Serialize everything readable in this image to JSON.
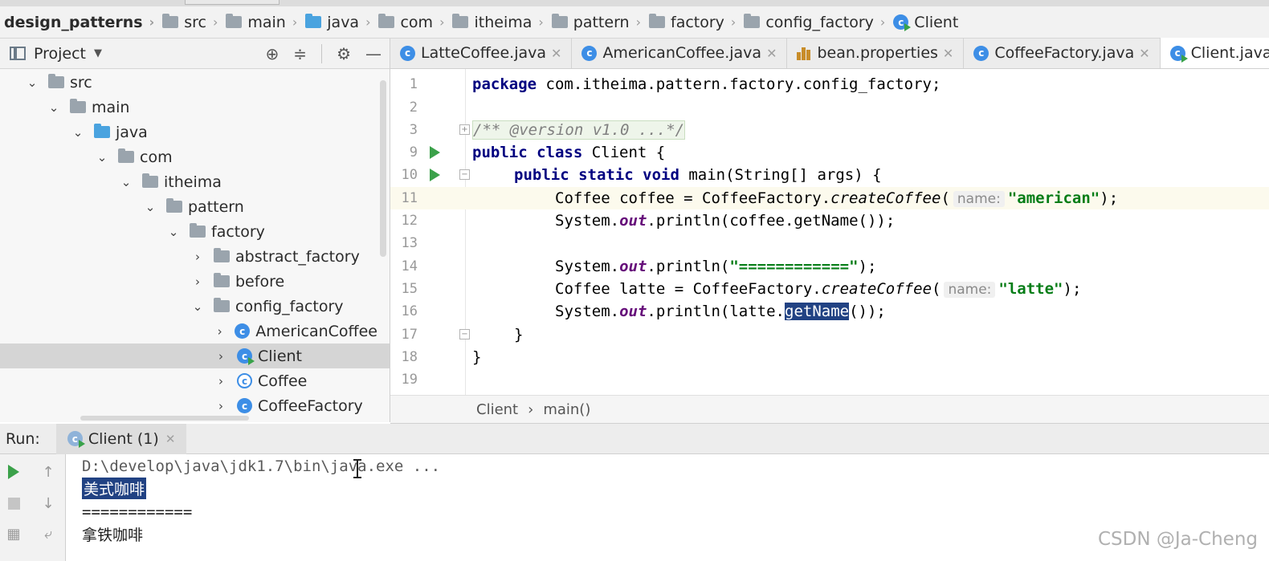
{
  "breadcrumb": {
    "items": [
      "design_patterns",
      "src",
      "main",
      "java",
      "com",
      "itheima",
      "pattern",
      "factory",
      "config_factory",
      "Client"
    ]
  },
  "project_panel": {
    "title": "Project",
    "tree": [
      {
        "label": "src",
        "kind": "folder",
        "expanded": true
      },
      {
        "label": "main",
        "kind": "folder",
        "expanded": true
      },
      {
        "label": "java",
        "kind": "source-folder",
        "expanded": true
      },
      {
        "label": "com",
        "kind": "package",
        "expanded": true
      },
      {
        "label": "itheima",
        "kind": "package",
        "expanded": true
      },
      {
        "label": "pattern",
        "kind": "package",
        "expanded": true
      },
      {
        "label": "factory",
        "kind": "package",
        "expanded": true
      },
      {
        "label": "abstract_factory",
        "kind": "package",
        "expanded": false
      },
      {
        "label": "before",
        "kind": "package",
        "expanded": false
      },
      {
        "label": "config_factory",
        "kind": "package",
        "expanded": true
      },
      {
        "label": "AmericanCoffee",
        "kind": "class",
        "expanded": false
      },
      {
        "label": "Client",
        "kind": "runnable-class",
        "expanded": false,
        "selected": true
      },
      {
        "label": "Coffee",
        "kind": "abstract-class",
        "expanded": false
      },
      {
        "label": "CoffeeFactory",
        "kind": "class",
        "expanded": false
      }
    ]
  },
  "editor_tabs": [
    {
      "label": "LatteCoffee.java",
      "icon": "class-icon"
    },
    {
      "label": "AmericanCoffee.java",
      "icon": "class-icon"
    },
    {
      "label": "bean.properties",
      "icon": "properties-icon"
    },
    {
      "label": "CoffeeFactory.java",
      "icon": "class-icon"
    },
    {
      "label": "Client.java",
      "icon": "runnable-class-icon",
      "active": true
    }
  ],
  "editor": {
    "line_numbers": [
      "1",
      "2",
      "3",
      "9",
      "10",
      "11",
      "12",
      "13",
      "14",
      "15",
      "16",
      "17",
      "18",
      "19"
    ],
    "lines": {
      "l1_kw": "package",
      "l1_rest": " com.itheima.pattern.factory.config_factory;",
      "l3_comment": "/** @version v1.0 ...*/",
      "l9_kw": "public class",
      "l9_rest": " Client {",
      "l10_kw": "public static void",
      "l10_rest": " main(String[] args) {",
      "l11_a": "Coffee coffee = CoffeeFactory.",
      "l11_method": "createCoffee",
      "l11_b": "(",
      "l11_hint": "name:",
      "l11_str": "\"american\"",
      "l11_c": ");",
      "l12_a": "System.",
      "l12_field": "out",
      "l12_b": ".println(coffee.getName());",
      "l14_a": "System.",
      "l14_field": "out",
      "l14_b": ".println(",
      "l14_str": "\"============\"",
      "l14_c": ");",
      "l15_a": "Coffee latte = CoffeeFactory.",
      "l15_method": "createCoffee",
      "l15_b": "(",
      "l15_hint": "name:",
      "l15_str": "\"latte\"",
      "l15_c": ");",
      "l16_a": "System.",
      "l16_field": "out",
      "l16_b": ".println(latte.",
      "l16_sel": "getName",
      "l16_c": "());",
      "l17": "}",
      "l18": "}"
    },
    "crumb": [
      "Client",
      "main()"
    ]
  },
  "run_panel": {
    "label": "Run:",
    "tab_label": "Client (1)",
    "console": {
      "command": "D:\\develop\\java\\jdk1.7\\bin\\java.exe ...",
      "line1": "美式咖啡",
      "line2": "============",
      "line3": "拿铁咖啡"
    }
  },
  "watermark": "CSDN @Ja-Cheng",
  "colors": {
    "keyword": "#000080",
    "string": "#067d17",
    "selection": "#214283",
    "run_green": "#3ba14a",
    "class_icon": "#3d8ee6"
  }
}
